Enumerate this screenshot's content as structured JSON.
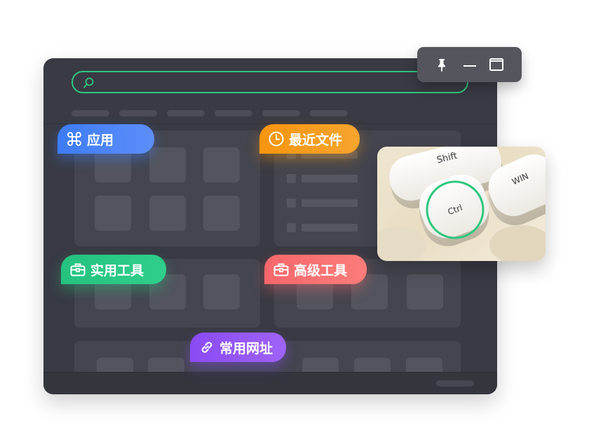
{
  "window": {
    "search": {
      "placeholder": ""
    },
    "filter_pill_count": 6
  },
  "window_controls": [
    {
      "name": "pin-icon"
    },
    {
      "name": "minimize-icon"
    },
    {
      "name": "maximize-icon"
    }
  ],
  "tags": {
    "apps": {
      "label": "应用",
      "icon": "command-icon",
      "color": "#3d7cf7"
    },
    "recent": {
      "label": "最近文件",
      "icon": "clock-icon",
      "color": "#f7950f"
    },
    "tools": {
      "label": "实用工具",
      "icon": "toolbox-icon",
      "color": "#25c27f"
    },
    "adv": {
      "label": "高级工具",
      "icon": "toolbox-icon",
      "color": "#f7676b"
    },
    "urls": {
      "label": "常用网址",
      "icon": "link-icon",
      "color": "#8a4bf5"
    }
  },
  "keyboard_photo": {
    "keys": {
      "shift": "Shift",
      "ctrl": "Ctrl",
      "win": "WIN"
    },
    "highlight_color": "#2ec77e"
  },
  "colors": {
    "accent": "#2ec77e",
    "window_bg": "#393a43"
  }
}
